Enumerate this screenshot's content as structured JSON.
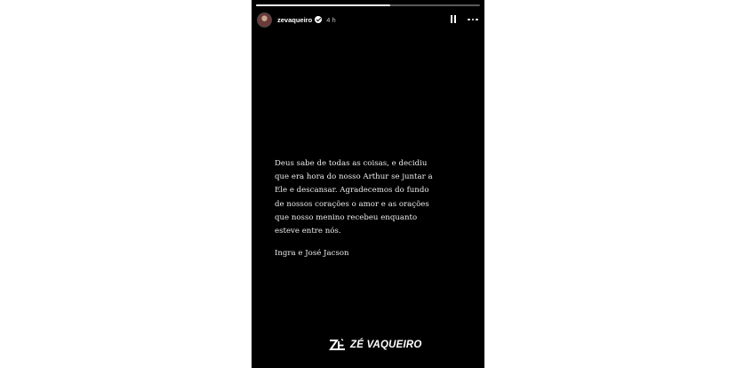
{
  "story": {
    "progress": 0.6,
    "header": {
      "username": "zevaqueiro",
      "timestamp": "4 h",
      "verified": true
    },
    "message_lines": [
      "Deus sabe de todas as coisas, e decidiu",
      "que era hora do nosso Arthur se juntar a",
      "Ele e descansar. Agradecemos do fundo",
      "de nossos corações o amor e as orações",
      "que nosso menino recebeu enquanto",
      "esteve entre nós."
    ],
    "signature": "Ingra e José Jacson",
    "brand": {
      "mark": "ZÉ",
      "name": "ZÉ VAQUEIRO"
    }
  },
  "icons": {
    "pause": "pause-icon",
    "more": "more-options-icon",
    "verified": "verified-badge-icon"
  },
  "colors": {
    "story_background": "#000000",
    "page_background": "#ffffff",
    "text": "#ececec"
  }
}
